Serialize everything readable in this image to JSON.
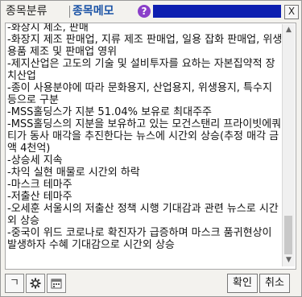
{
  "tabs": [
    {
      "label": "종목분류"
    },
    {
      "label": "종목메모"
    }
  ],
  "help_icon": "?",
  "close_icon": "X",
  "memo": {
    "text": "-화장지 제조, 판매\n-화장지 제조 판매업, 지류 제조 판매업, 일용 잡화 판매업, 위생용품 제조 및 판매업 영위\n-제지산업은 고도의 기술 및 설비투자를 요하는 자본집약적 장치산업\n-종이 사용분야에 따라 문화용지, 산업용지, 위생용지, 특수지 등으로 구분\n-MSS홀딩스가 지분 51.04% 보유로 최대주주\n-MSS홀딩스의 지분을 보유하고 있는 모건스탠리 프라이빗에쿼티가 동사 매각을 추진한다는 뉴스에 시간외 상승(추정 매각 금액 4천억)\n-상승세 지속\n-차익 실현 매물로 시간외 하락\n-마스크 테마주\n-저출산 테마주\n-오세훈 서울시의 저출산 정책 시행 기대감과 관련 뉴스로 시간외 상승\n-중국이 위드 코로나로 확진자가 급증하며 마스크 품귀현상이 발생하자 수혜 기대감으로 시간외 상승"
  },
  "toolbar": {
    "btn1": "ㄱ",
    "btn2": "gear-icon",
    "btn3": "calendar-icon",
    "ok_label": "확인",
    "cancel_label": "취소"
  }
}
